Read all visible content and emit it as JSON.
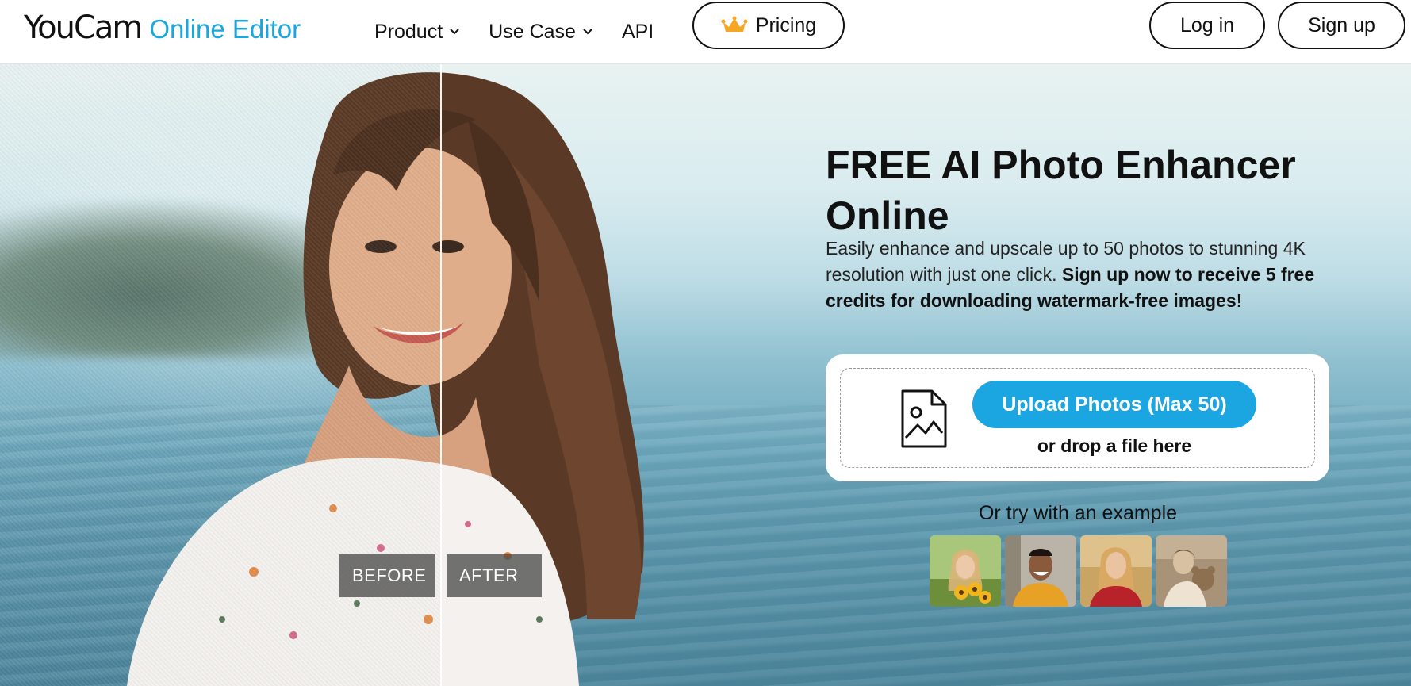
{
  "header": {
    "logo_main": "YouCam",
    "logo_sub": "Online Editor",
    "nav": [
      {
        "label": "Product"
      },
      {
        "label": "Use Case"
      },
      {
        "label": "API"
      }
    ],
    "pricing_label": "Pricing",
    "login_label": "Log in",
    "signup_label": "Sign up"
  },
  "hero": {
    "title": "FREE AI Photo Enhancer Online",
    "description_plain": "Easily enhance and upscale up to 50 photos to stunning 4K resolution with just one click. ",
    "description_bold": "Sign up now to receive 5 free credits for downloading watermark-free images!",
    "before_label": "BEFORE",
    "after_label": "AFTER",
    "upload_button": "Upload Photos (Max 50)",
    "drop_text": "or drop a file here",
    "example_label": "Or try with an example"
  },
  "icons": {
    "crown": "crown-icon",
    "chevron": "chevron-down-icon",
    "file": "image-file-icon"
  },
  "colors": {
    "brand_blue": "#1ba6e1",
    "crown_orange": "#f5a623",
    "text_dark": "#111111"
  }
}
